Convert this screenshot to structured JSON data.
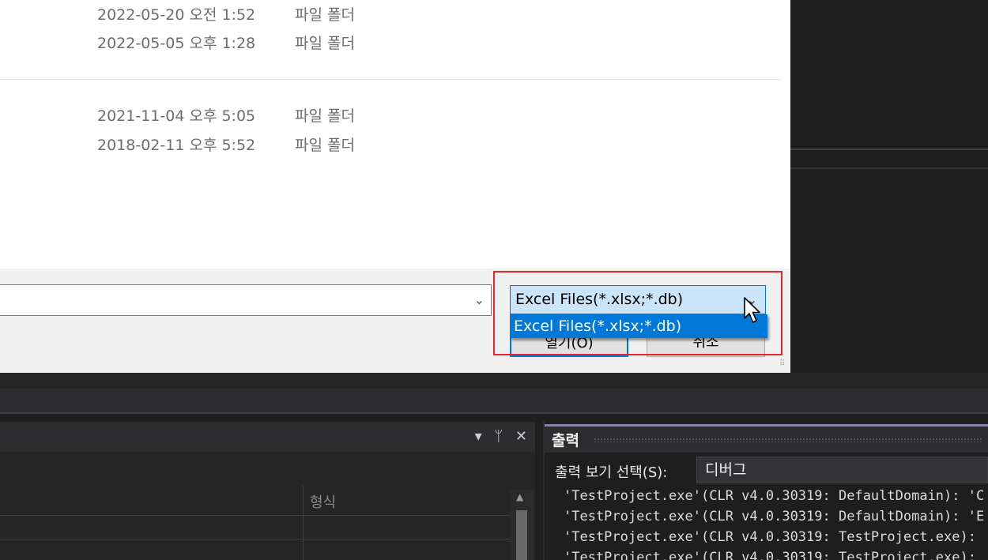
{
  "dialog": {
    "file_rows": [
      {
        "date": "2022-05-20 오전 1:52",
        "type": "파일 폴더"
      },
      {
        "date": "2022-05-05 오후 1:28",
        "type": "파일 폴더"
      },
      {
        "date": "2021-11-04 오후 5:05",
        "type": "파일 폴더"
      },
      {
        "date": "2018-02-11 오후 5:52",
        "type": "파일 폴더"
      }
    ],
    "filename_value": "",
    "filter_selected": "Excel Files(*.xlsx;*.db)",
    "filter_options": [
      "Excel Files(*.xlsx;*.db)"
    ],
    "open_button": "열기(O)",
    "cancel_button": "취소"
  },
  "left_panel": {
    "icons": [
      "dropdown-icon",
      "pin-icon",
      "close-icon"
    ],
    "column_header": "형식"
  },
  "output_panel": {
    "title": "출력",
    "select_label": "출력 보기 선택(S):",
    "select_value": "디버그",
    "lines": [
      "'TestProject.exe'(CLR v4.0.30319: DefaultDomain): 'C",
      "'TestProject.exe'(CLR v4.0.30319: DefaultDomain): 'E",
      "'TestProject.exe'(CLR v4.0.30319: TestProject.exe):",
      "'TestProject.exe'(CLR v4.0.30319: TestProject.exe):"
    ]
  },
  "colors": {
    "selection_blue": "#0078d7",
    "highlight_red": "#e3262f",
    "ide_background": "#1e1e1e",
    "output_accent": "#8e7cc3"
  }
}
